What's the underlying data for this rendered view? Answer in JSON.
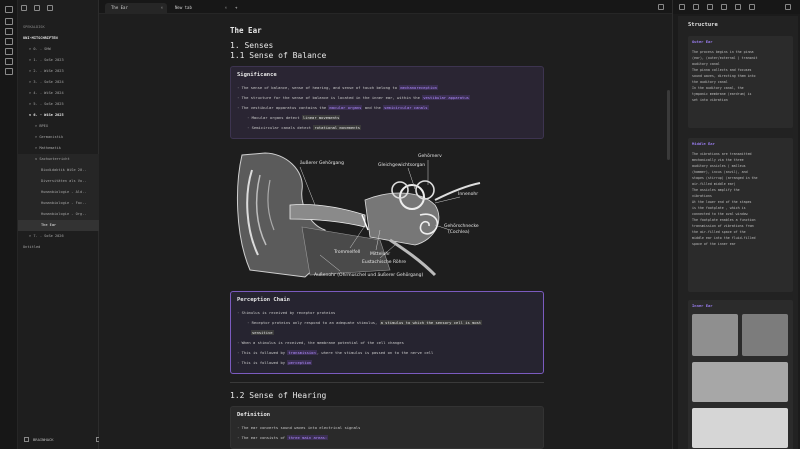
{
  "sidebar": {
    "vault_name": "BRAINHACK",
    "items": [
      {
        "label": "SPEKALDISK",
        "level": 0,
        "style": "dim"
      },
      {
        "label": "UNI-MITSCHRIFTEN",
        "level": 0,
        "style": "bold"
      },
      {
        "label": "> 0. - SHW",
        "level": 1,
        "style": ""
      },
      {
        "label": "> 1. - SoSe 2023",
        "level": 1,
        "style": ""
      },
      {
        "label": "> 2. - WiSe 2023",
        "level": 1,
        "style": ""
      },
      {
        "label": "> 3. - SoSe 2024",
        "level": 1,
        "style": ""
      },
      {
        "label": "> 4. - WiSe 2024",
        "level": 1,
        "style": ""
      },
      {
        "label": "> 5. - SoSe 2025",
        "level": 1,
        "style": ""
      },
      {
        "label": "v 6. - WiSe 2025",
        "level": 1,
        "style": "bold"
      },
      {
        "label": "> BPEX",
        "level": 2,
        "style": ""
      },
      {
        "label": "> Germanistik",
        "level": 2,
        "style": ""
      },
      {
        "label": "> Mathematik",
        "level": 2,
        "style": ""
      },
      {
        "label": "v Sachunterricht",
        "level": 2,
        "style": "group"
      },
      {
        "label": "Biodidaktik WiSe 20..",
        "level": 3,
        "style": "group"
      },
      {
        "label": "Diversitäten als Vo..",
        "level": 3,
        "style": "group"
      },
      {
        "label": "Humanbiologie - Ald..",
        "level": 3,
        "style": "group"
      },
      {
        "label": "Humanbiologie - Fac..",
        "level": 3,
        "style": "group"
      },
      {
        "label": "Humanbiologie - Org..",
        "level": 3,
        "style": "group"
      },
      {
        "label": "The Ear",
        "level": 3,
        "style": "sel"
      },
      {
        "label": "> 7. - SoSe 2026",
        "level": 1,
        "style": ""
      },
      {
        "label": "Untitled",
        "level": 0,
        "style": ""
      }
    ]
  },
  "tabs": [
    {
      "label": "The Ear",
      "active": true
    },
    {
      "label": "New tab",
      "active": false
    }
  ],
  "doc": {
    "title": "The Ear",
    "h_senses": "1. Senses",
    "h_balance": "1.1 Sense of Balance",
    "significance_title": "Significance",
    "sig_1a": "The sense of balance, sense of hearing, and sense of touch belong to",
    "sig_1b": "mechanoreception",
    "sig_2a": "The structure for the sense of balance is located in the inner ear, within the",
    "sig_2b": "vestibular apparatus",
    "sig_3a": "The vestibular apparatus contains the",
    "sig_3b": "macular organs",
    "sig_3c": "and the",
    "sig_3d": "semicircular canals",
    "sig_4a": "Macular organs detect",
    "sig_4b": "linear movements",
    "sig_5a": "Semicircular canals detect",
    "sig_5b": "rotational movements",
    "perception_title": "Perception Chain",
    "per_1": "Stimulus is received by receptor proteins",
    "per_2a": "Receptor proteins only respond to an adequate stimulus,",
    "per_2b": "a stimulus to which the sensory cell is most",
    "per_2c": "sensitive",
    "per_3": "When a stimulus is received, the membrane potential of the cell changes",
    "per_4a": "This is followed by",
    "per_4b": "transmission",
    "per_4c": ", where the stimulus is passed on to the nerve cell",
    "per_5a": "This is followed by",
    "per_5b": "perception",
    "h_hearing": "1.2 Sense of Hearing",
    "definition_title": "Definition",
    "def_1": "The ear converts sound waves into electrical signals",
    "def_2a": "The ear consists of",
    "def_2b": "three main areas:"
  },
  "ear_labels": {
    "gehoergang": "äußerer Gehörgang",
    "gehoernerv": "Gehörnerv",
    "gleich": "Gleichgewichtsorgan",
    "innenohr": "Innenohr",
    "schnecke1": "Gehörschnecke",
    "schnecke2": "(Cochlea)",
    "trommelfell": "Trommelfell",
    "mittelohr": "Mittelohr",
    "eustach": "Eustachische Röhre",
    "aussenohr": "Außenohr (Ohrmuschel und äußerer Gehörgang)"
  },
  "right": {
    "title": "Structure",
    "outer_title": "Outer Ear",
    "outer_lines": [
      "The process begins in the pinna",
      "(ear), (outer/external ) transmit",
      "auditory canal",
      "The pinna collects and focuses",
      "sound waves, directing them into",
      "the auditory canal",
      "In the auditory canal, the",
      "tympanic membrane (eardrum) is",
      "set into vibration"
    ],
    "middle_title": "Middle Ear",
    "middle_lines": [
      "The vibrations are transmitted",
      "mechanically via the three",
      "auditory ossicles ( malleus",
      "(hammer), incus (anvil), and",
      "stapes (stirrup) (arranged in the",
      "air-filled middle ear)",
      "The ossicles amplify the",
      "vibrations",
      "At the lower end of the stapes",
      "is the footplate , which is",
      "connected to the oval window",
      "The footplate enables a function",
      "transmission of vibrations from",
      "the air-filled space of the",
      "middle ear into the fluid-filled",
      "space of the inner ear"
    ],
    "inner_title": "Inner Ear"
  }
}
